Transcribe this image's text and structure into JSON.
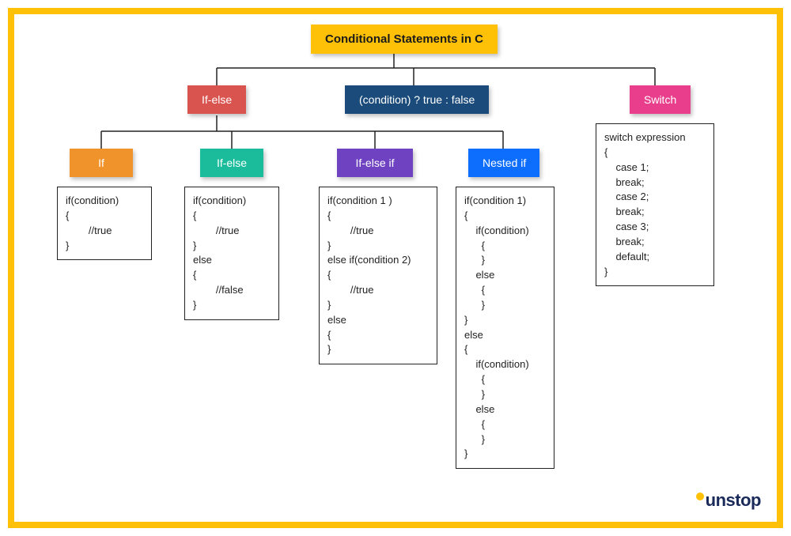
{
  "root": {
    "title": "Conditional Statements in C"
  },
  "level1": {
    "ifelse": "If-else",
    "ternary": "(condition) ? true : false",
    "switch": "Switch"
  },
  "level2": {
    "if": "If",
    "ifelse": "If-else",
    "elif": "If-else if",
    "nested": "Nested if"
  },
  "code": {
    "if": "if(condition)\n{\n        //true\n}",
    "ifelse": "if(condition)\n{\n        //true\n}\nelse\n{\n        //false\n}",
    "elif": "if(condition 1 )\n{\n        //true\n}\nelse if(condition 2)\n{\n        //true\n}\nelse\n{\n}",
    "nested": "if(condition 1)\n{\n    if(condition)\n      {\n      }\n    else\n      {\n      }\n}\nelse\n{\n    if(condition)\n      {\n      }\n    else\n      {\n      }\n}",
    "switch": "switch expression\n{\n    case 1;\n    break;\n    case 2;\n    break;\n    case 3;\n    break;\n    default;\n}"
  },
  "logo": {
    "text": "unstop"
  }
}
